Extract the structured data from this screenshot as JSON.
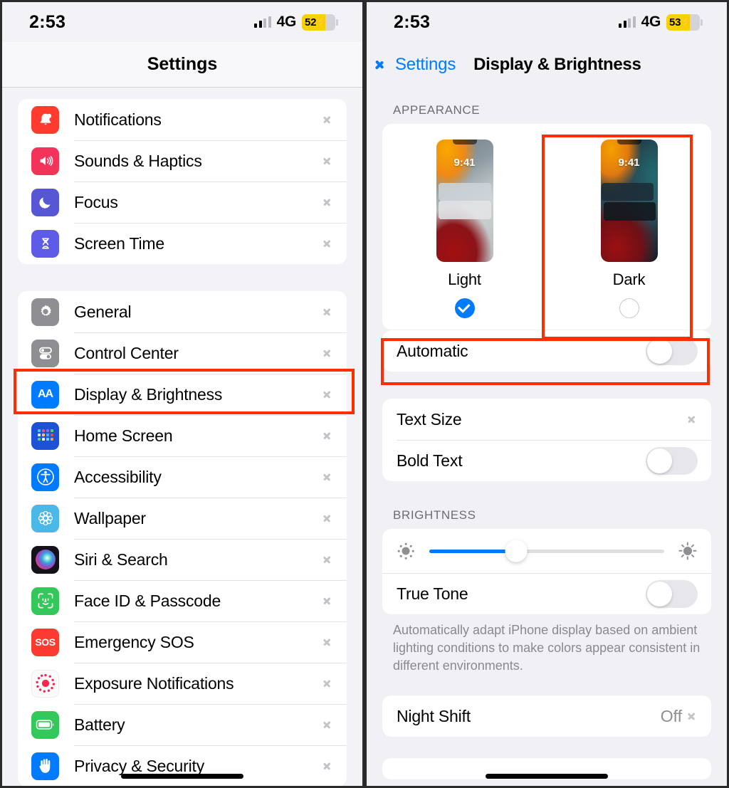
{
  "left": {
    "status": {
      "time": "2:53",
      "network": "4G",
      "battery_percent": "52",
      "charging": true
    },
    "nav_title": "Settings",
    "groups": [
      {
        "items": [
          {
            "label": "Notifications",
            "icon": "bell-icon"
          },
          {
            "label": "Sounds & Haptics",
            "icon": "speaker-icon"
          },
          {
            "label": "Focus",
            "icon": "moon-icon"
          },
          {
            "label": "Screen Time",
            "icon": "hourglass-icon"
          }
        ]
      },
      {
        "items": [
          {
            "label": "General",
            "icon": "gear-icon"
          },
          {
            "label": "Control Center",
            "icon": "toggles-icon"
          },
          {
            "label": "Display & Brightness",
            "icon": "aa-icon",
            "highlighted": true
          },
          {
            "label": "Home Screen",
            "icon": "grid-icon"
          },
          {
            "label": "Accessibility",
            "icon": "accessibility-icon"
          },
          {
            "label": "Wallpaper",
            "icon": "flower-icon"
          },
          {
            "label": "Siri & Search",
            "icon": "siri-icon"
          },
          {
            "label": "Face ID & Passcode",
            "icon": "faceid-icon"
          },
          {
            "label": "Emergency SOS",
            "icon": "sos-icon"
          },
          {
            "label": "Exposure Notifications",
            "icon": "exposure-icon"
          },
          {
            "label": "Battery",
            "icon": "battery-icon"
          },
          {
            "label": "Privacy & Security",
            "icon": "hand-icon"
          }
        ]
      }
    ]
  },
  "right": {
    "status": {
      "time": "2:53",
      "network": "4G",
      "battery_percent": "53",
      "charging": true
    },
    "back_label": "Settings",
    "nav_title": "Display & Brightness",
    "appearance": {
      "header": "APPEARANCE",
      "options": [
        {
          "label": "Light",
          "selected": true,
          "preview_time": "9:41"
        },
        {
          "label": "Dark",
          "selected": false,
          "preview_time": "9:41",
          "highlighted": true
        }
      ],
      "automatic": {
        "label": "Automatic",
        "value": "off",
        "highlighted": true
      }
    },
    "text_group": [
      {
        "label": "Text Size",
        "type": "chevron"
      },
      {
        "label": "Bold Text",
        "type": "toggle",
        "value": "off"
      }
    ],
    "brightness": {
      "header": "BRIGHTNESS",
      "slider_percent": 37,
      "true_tone": {
        "label": "True Tone",
        "value": "off"
      },
      "footnote": "Automatically adapt iPhone display based on ambient lighting conditions to make colors appear consistent in different environments."
    },
    "night_shift": {
      "label": "Night Shift",
      "value": "Off"
    }
  }
}
